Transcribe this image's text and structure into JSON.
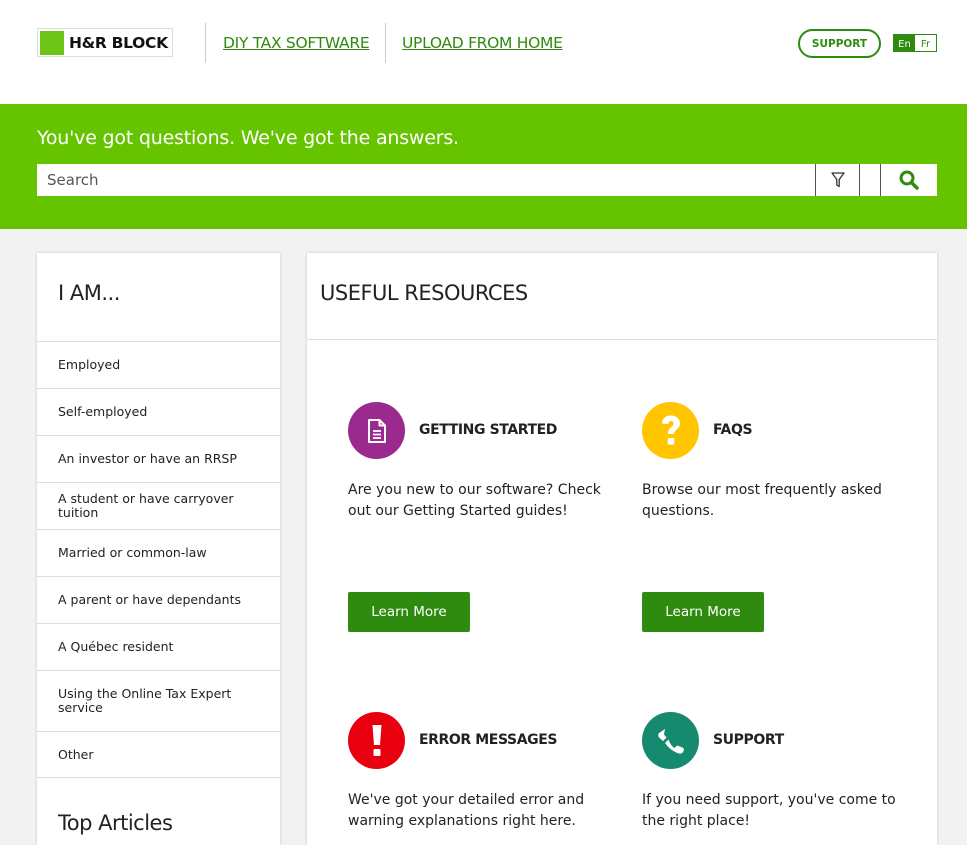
{
  "header": {
    "logo_text": "H&R BLOCK",
    "nav": [
      "DIY TAX SOFTWARE",
      "UPLOAD FROM HOME"
    ],
    "support_label": "SUPPORT",
    "lang": {
      "en": "En",
      "fr": "Fr",
      "selected": "En"
    }
  },
  "hero": {
    "title": "You've got questions. We've got the answers.",
    "search_placeholder": "Search"
  },
  "sidebar": {
    "heading": "I AM...",
    "items": [
      "Employed",
      "Self-employed",
      "An investor or have an RRSP",
      "A student or have carryover tuition",
      "Married or common-law",
      "A parent or have dependants",
      "A Québec resident",
      "Using the Online Tax Expert service",
      "Other"
    ],
    "top_articles": "Top Articles"
  },
  "main": {
    "heading": "USEFUL RESOURCES",
    "cards": [
      {
        "title": "GETTING STARTED",
        "desc": "Are you new to our software? Check out our Getting Started guides!",
        "button": "Learn More",
        "icon": "document-icon",
        "color": "#9b2a8f"
      },
      {
        "title": "FAQS",
        "desc": "Browse our most frequently asked questions.",
        "button": "Learn More",
        "icon": "question-icon",
        "color": "#ffc600"
      },
      {
        "title": "ERROR MESSAGES",
        "desc": "We've got your detailed error and warning explanations right here.",
        "icon": "exclamation-icon",
        "color": "#e8000e"
      },
      {
        "title": "SUPPORT",
        "desc": "If you need support, you've come to the right place!",
        "icon": "phone-icon",
        "color": "#158a6e"
      }
    ]
  },
  "colors": {
    "brand_green": "#66c300",
    "dark_green": "#2e8b0f"
  }
}
